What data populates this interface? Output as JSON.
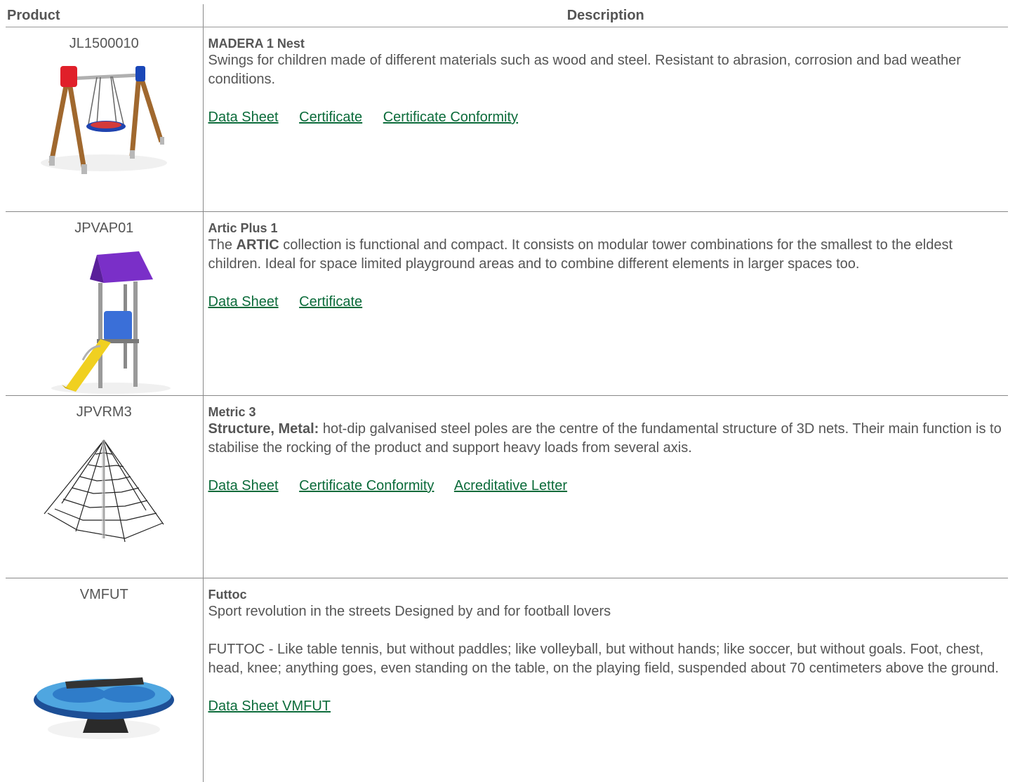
{
  "table": {
    "headers": {
      "product": "Product",
      "description": "Description"
    },
    "rows": [
      {
        "code": "JL1500010",
        "name": "MADERA 1 Nest",
        "text": "Swings for children made of different materials such as wood and steel. Resistant to abrasion, corrosion and bad weather conditions.",
        "links": [
          "Data Sheet",
          "Certificate",
          "Certificate Conformity"
        ]
      },
      {
        "code": "JPVAP01",
        "name": "Artic Plus 1",
        "text_prefix": "The ",
        "text_bold": "ARTIC",
        "text_rest": " collection is functional and compact. It consists on modular tower combinations for the smallest to the eldest children. Ideal for space limited playground areas and to combine different elements in larger spaces too.",
        "links": [
          "Data Sheet",
          "Certificate"
        ]
      },
      {
        "code": "JPVRM3",
        "name": "Metric 3",
        "text_bold": "Structure, Metal:",
        "text_rest": " hot-dip galvanised steel poles are the centre of the fundamental structure of 3D nets. Their main function is to stabilise the rocking of the product and support heavy loads from several axis.",
        "links": [
          "Data Sheet",
          "Certificate Conformity",
          "Acreditative Letter"
        ]
      },
      {
        "code": "VMFUT",
        "name": "Futtoc",
        "text": "Sport revolution in the streets Designed by and for football lovers",
        "text2": "FUTTOC - Like table tennis, but without paddles; like volleyball, but without hands; like soccer, but without goals. Foot, chest, head, knee; anything goes, even standing on the table, on the playing field, suspended about 70 centimeters above the ground.",
        "links": [
          "Data Sheet VMFUT"
        ]
      }
    ]
  },
  "colors": {
    "text": "#555555",
    "link": "#0b6b3a",
    "border": "#888888"
  }
}
